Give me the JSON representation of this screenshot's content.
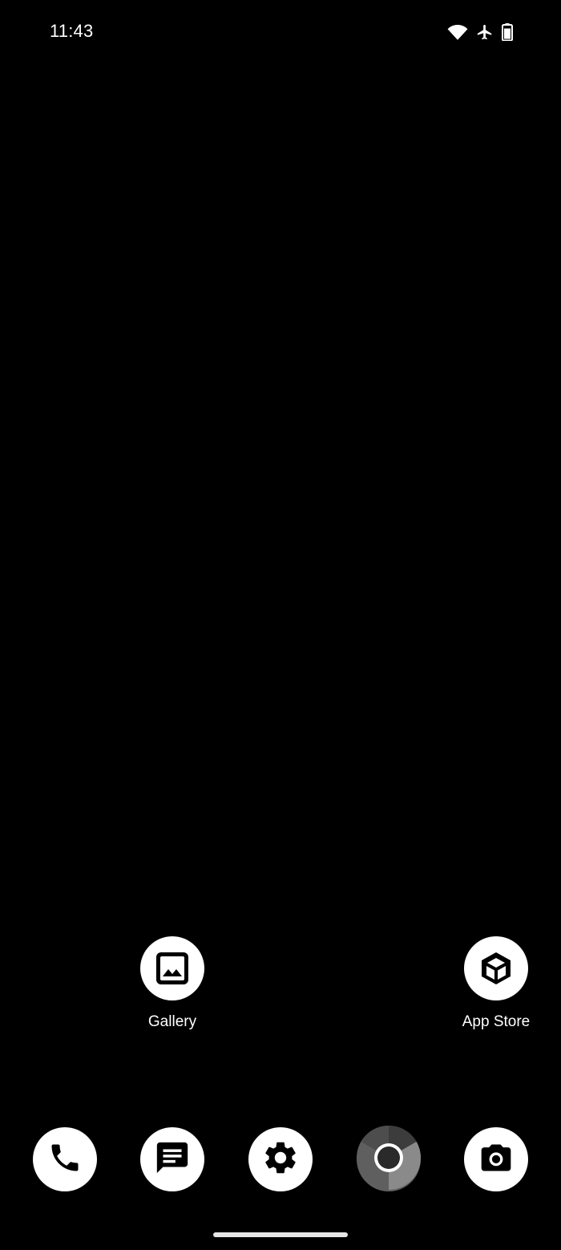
{
  "status_bar": {
    "time": "11:43",
    "icons": [
      "wifi-icon",
      "airplane-icon",
      "battery-icon"
    ]
  },
  "home_apps": [
    {
      "label": "Gallery",
      "icon": "gallery-icon"
    },
    {
      "label": "App Store",
      "icon": "app-store-icon"
    }
  ],
  "dock": [
    {
      "icon": "phone-icon"
    },
    {
      "icon": "messages-icon"
    },
    {
      "icon": "settings-icon"
    },
    {
      "icon": "chrome-icon"
    },
    {
      "icon": "camera-icon"
    }
  ],
  "colors": {
    "background": "#000000",
    "icon_bg": "#ffffff",
    "icon_fg": "#000000",
    "chrome_bg": "#5f5f5f"
  }
}
